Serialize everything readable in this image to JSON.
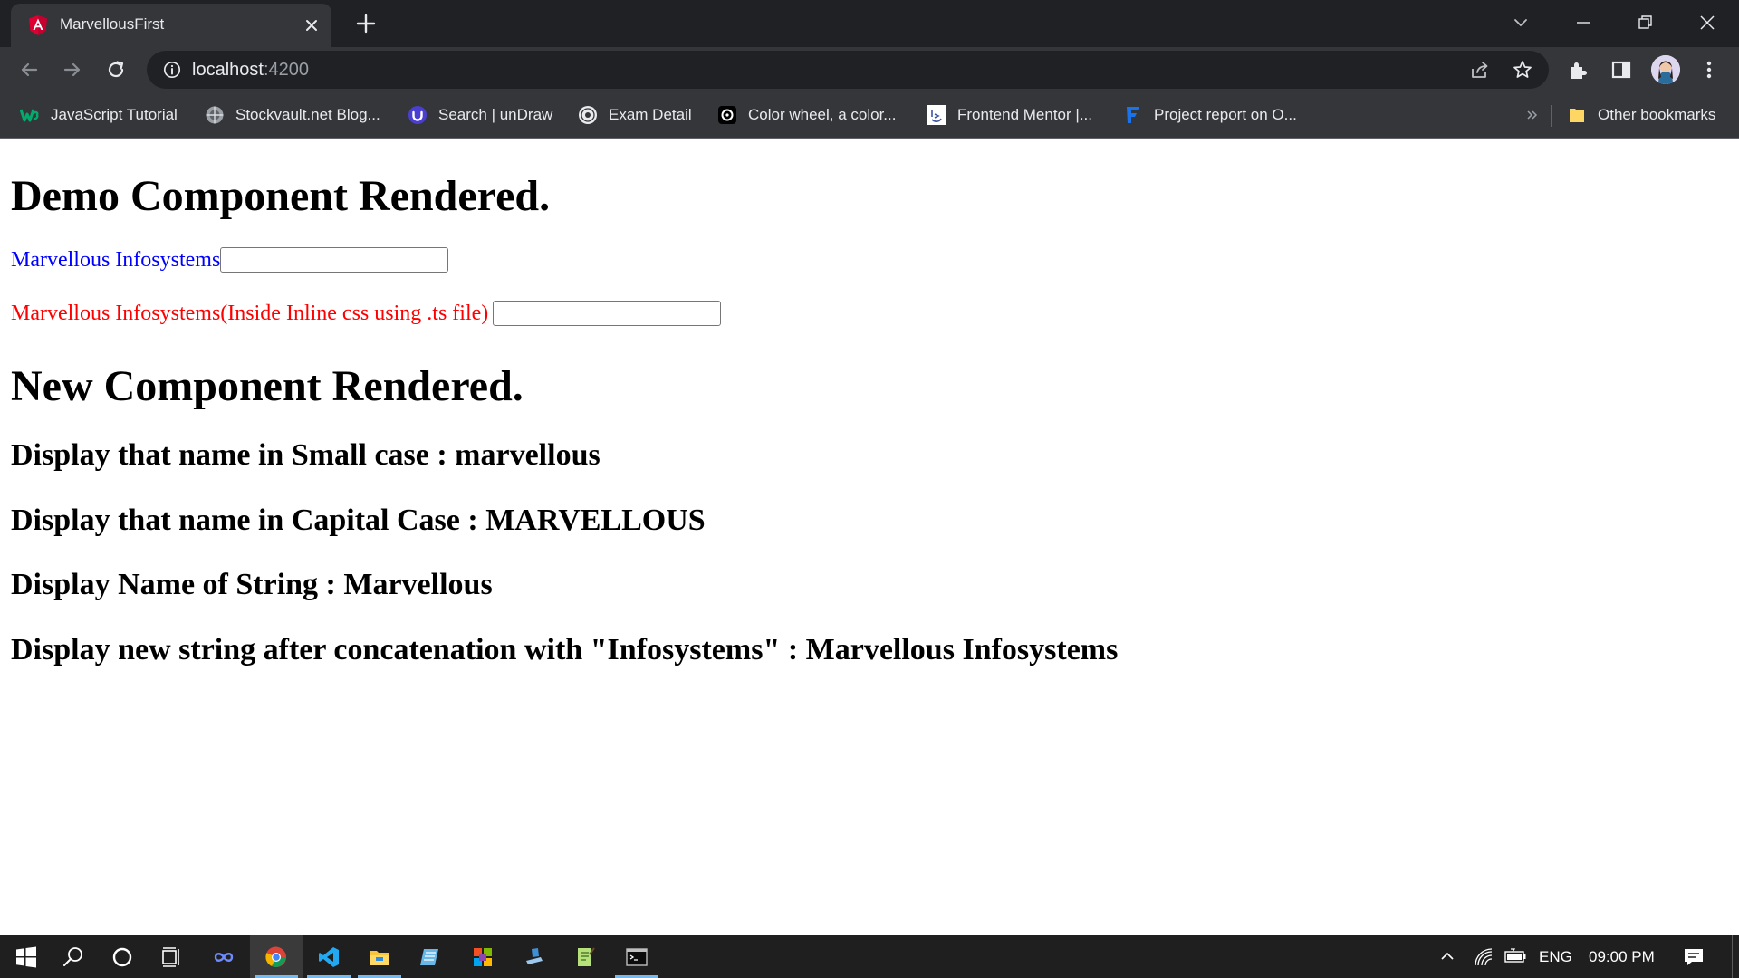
{
  "browser": {
    "tab_title": "MarvellousFirst",
    "url_host": "localhost",
    "url_port": ":4200",
    "bookmarks": [
      {
        "label": "JavaScript Tutorial",
        "icon": "w3schools-icon"
      },
      {
        "label": "Stockvault.net Blog...",
        "icon": "stockvault-icon"
      },
      {
        "label": "Search | unDraw",
        "icon": "undraw-icon"
      },
      {
        "label": "Exam Detail",
        "icon": "exam-icon"
      },
      {
        "label": "Color wheel, a color...",
        "icon": "canva-icon"
      },
      {
        "label": "Frontend Mentor |...",
        "icon": "frontend-mentor-icon"
      },
      {
        "label": "Project report on O...",
        "icon": "project-report-icon"
      }
    ],
    "other_bookmarks": "Other bookmarks",
    "colors": {
      "tabstrip": "#202124",
      "toolbar": "#35363a",
      "omnibox": "#202124"
    }
  },
  "page": {
    "demo_heading": "Demo Component Rendered.",
    "label_blue": "Marvellous Infosystems",
    "label_red": "Marvellous Infosystems(Inside Inline css using .ts file)",
    "new_heading": "New Component Rendered.",
    "lines": [
      "Display that name in Small case : marvellous",
      "Display that name in Capital Case : MARVELLOUS",
      "Display Name of String : Marvellous",
      "Display new string after concatenation with \"Infosystems\" : Marvellous Infosystems"
    ],
    "colors": {
      "blue_label": "#0000ff",
      "red_label": "#ff0000"
    }
  },
  "taskbar": {
    "apps": [
      "start-icon",
      "search-icon",
      "cortana-icon",
      "task-view-icon",
      "infinity-app-icon",
      "chrome-icon",
      "vscode-icon",
      "file-explorer-icon",
      "notepad-app-icon",
      "office-app-icon",
      "app-icon",
      "notepad-plus-icon",
      "terminal-icon"
    ],
    "language": "ENG",
    "time": "09:00 PM"
  }
}
